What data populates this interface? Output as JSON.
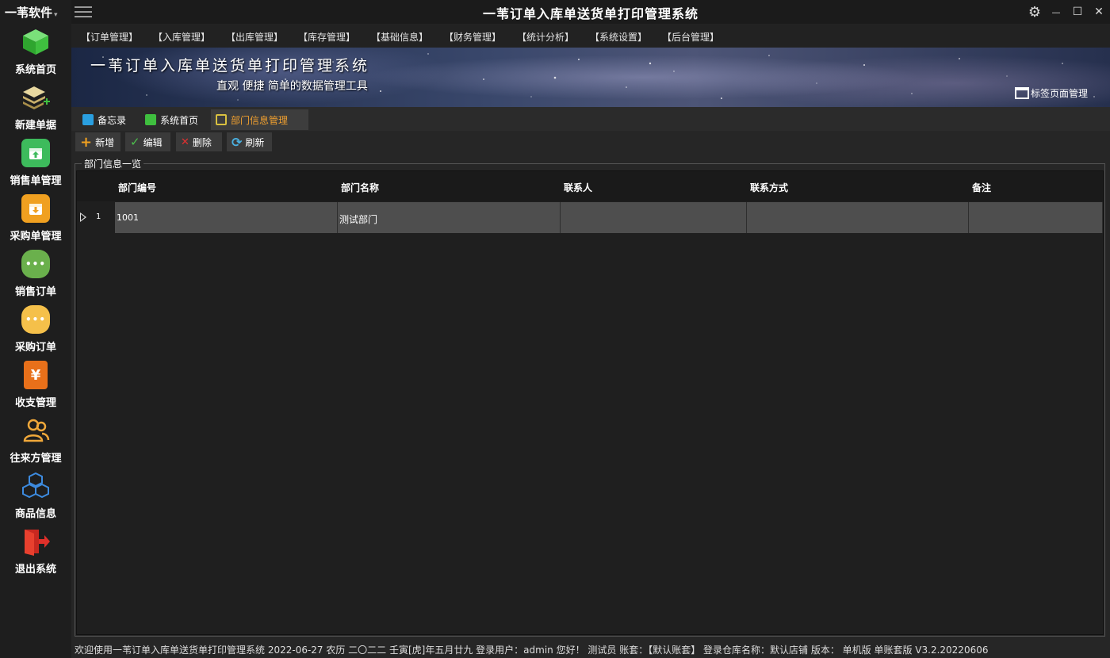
{
  "brand": {
    "name": "一苇软件",
    "caret": "▾"
  },
  "window": {
    "title": "一苇订单入库单送货单打印管理系统",
    "settings_glyph": "⚙",
    "minimize_glyph": "—",
    "maximize_glyph": "☐",
    "close_glyph": "✕"
  },
  "sidebar": {
    "items": [
      {
        "label": "系统首页",
        "icon": "cube-icon",
        "color": "#3fbf3f",
        "glyph": ""
      },
      {
        "label": "新建单据",
        "icon": "stack-add-icon",
        "color": "#c9b06b",
        "glyph": ""
      },
      {
        "label": "销售单管理",
        "icon": "box-up-icon",
        "color": "#3dbb5c",
        "glyph": ""
      },
      {
        "label": "采购单管理",
        "icon": "box-down-icon",
        "color": "#f0a020",
        "glyph": ""
      },
      {
        "label": "销售订单",
        "icon": "chat-dots-icon",
        "color": "#6ab04c",
        "glyph": "•••"
      },
      {
        "label": "采购订单",
        "icon": "chat-dots-icon",
        "color": "#f5c04a",
        "glyph": "•••"
      },
      {
        "label": "收支管理",
        "icon": "yen-icon",
        "color": "#e8701a",
        "glyph": "¥"
      },
      {
        "label": "往来方管理",
        "icon": "users-icon",
        "color": "#f0a83a",
        "glyph": ""
      },
      {
        "label": "商品信息",
        "icon": "cubes-icon",
        "color": "#3d8be0",
        "glyph": ""
      },
      {
        "label": "退出系统",
        "icon": "exit-icon",
        "color": "#e0302a",
        "glyph": ""
      }
    ]
  },
  "menubar": {
    "items": [
      "【订单管理】",
      "【入库管理】",
      "【出库管理】",
      "【库存管理】",
      "【基础信息】",
      "【财务管理】",
      "【统计分析】",
      "【系统设置】",
      "【后台管理】"
    ]
  },
  "banner": {
    "title": "一苇订单入库单送货单打印管理系统",
    "subtitle": "直观 便捷 简单的数据管理工具",
    "tab_manage_label": "标签页面管理"
  },
  "tabs": [
    {
      "label": "备忘录",
      "icon": "memo-icon",
      "color": "#2a9fe0"
    },
    {
      "label": "系统首页",
      "icon": "cube-icon",
      "color": "#3fbf3f"
    },
    {
      "label": "部门信息管理",
      "icon": "dept-icon",
      "color": "#d8c040"
    }
  ],
  "toolbar": {
    "add": {
      "label": "新增",
      "glyph": "+",
      "color": "#f0a020"
    },
    "edit": {
      "label": "编辑",
      "glyph": "✓",
      "color": "#4cc04c"
    },
    "delete": {
      "label": "删除",
      "glyph": "✕",
      "color": "#e03030"
    },
    "refresh": {
      "label": "刷新",
      "glyph": "⟳",
      "color": "#4ab0e0"
    }
  },
  "group": {
    "title": "部门信息一览"
  },
  "grid": {
    "columns": [
      "部门编号",
      "部门名称",
      "联系人",
      "联系方式",
      "备注"
    ],
    "rows": [
      {
        "num": "1",
        "cells": [
          "1001",
          "测试部门",
          "",
          "",
          ""
        ]
      }
    ]
  },
  "status": {
    "text": "欢迎使用一苇订单入库单送货单打印管理系统 2022-06-27 农历 二〇二二 壬寅[虎]年五月廿九 登录用户：admin 您好！ 测试员 账套：【默认账套】 登录仓库名称：默认店铺 版本： 单机版 单账套版 V3.2.20220606"
  }
}
